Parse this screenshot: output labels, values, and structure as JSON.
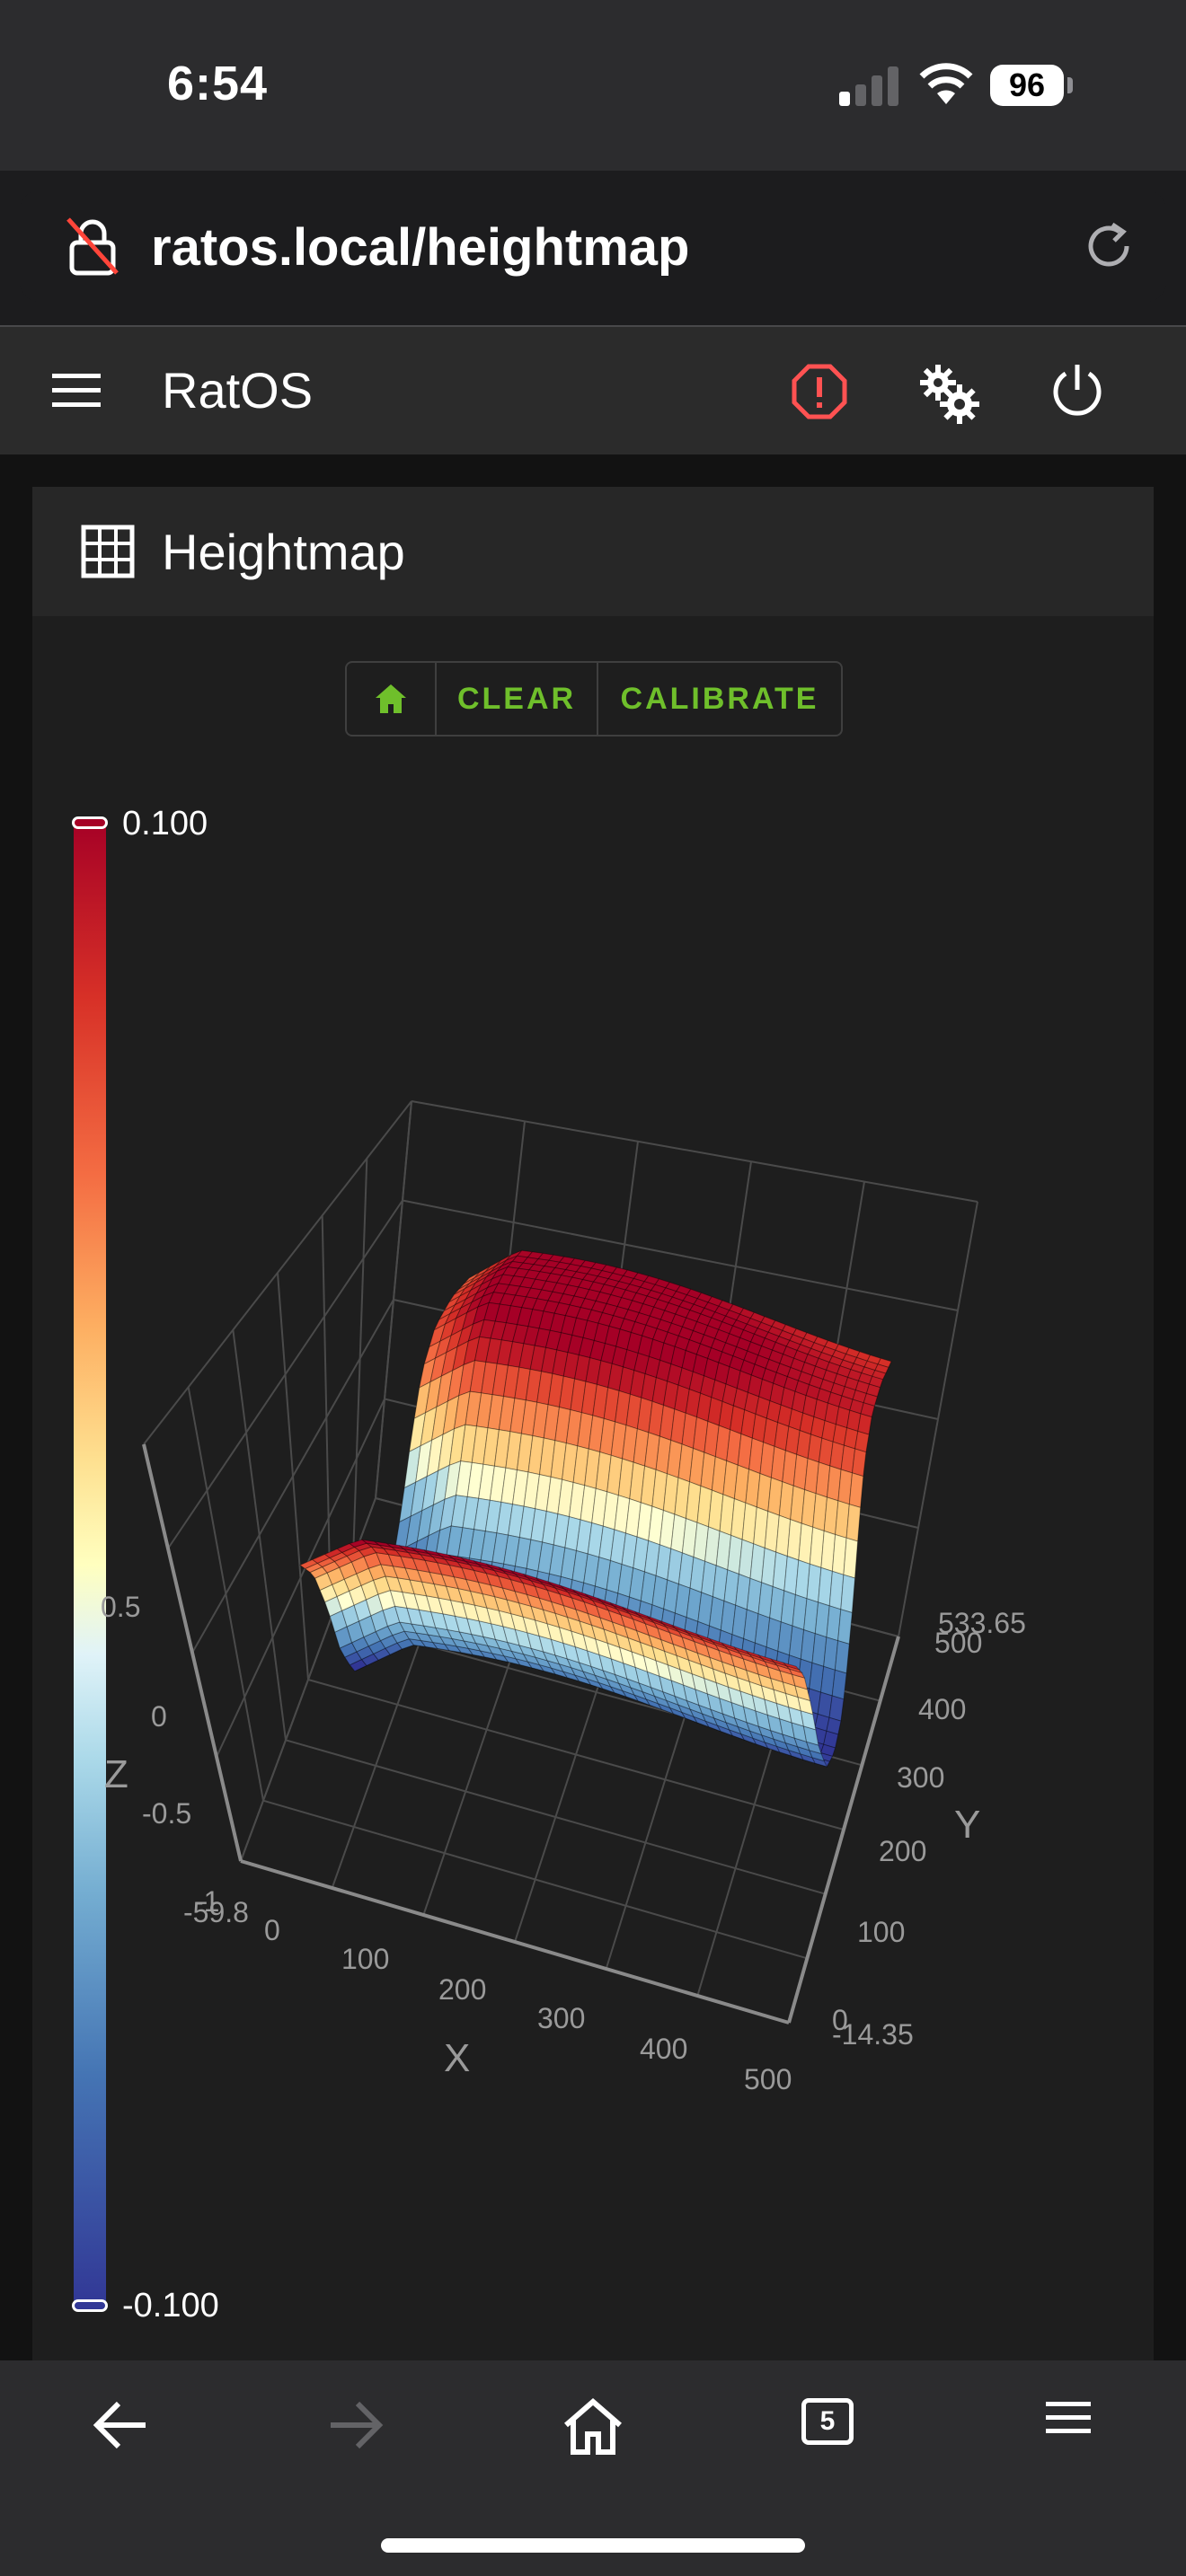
{
  "status_bar": {
    "time": "6:54",
    "battery": "96"
  },
  "browser": {
    "url": "ratos.local/heightmap",
    "tabs_count": "5"
  },
  "app": {
    "title": "RatOS"
  },
  "card": {
    "title": "Heightmap"
  },
  "toolbar": {
    "clear_label": "CLEAR",
    "calibrate_label": "CALIBRATE"
  },
  "colorbar": {
    "max_label": "0.100",
    "min_label": "-0.100",
    "max": 0.1,
    "min": -0.1
  },
  "chart_data": {
    "type": "surface3d",
    "x_title": "X",
    "y_title": "Y",
    "z_title": "Z",
    "x_ticks": [
      "-59.8",
      "0",
      "100",
      "200",
      "300",
      "400",
      "500"
    ],
    "y_ticks": [
      "-14.35",
      "0",
      "100",
      "200",
      "300",
      "400",
      "500",
      "533.65"
    ],
    "z_ticks": [
      "-1",
      "-0.5",
      "0",
      "0.5"
    ],
    "x_range": [
      -59.8,
      500
    ],
    "y_range": [
      -14.35,
      533.65
    ],
    "z_range": [
      -1,
      1
    ],
    "colorscale_range": [
      -0.1,
      0.1
    ],
    "y_profile": [
      [
        0,
        0.1
      ],
      [
        40,
        0.07
      ],
      [
        80,
        0.02
      ],
      [
        120,
        -0.04
      ],
      [
        160,
        -0.08
      ],
      [
        200,
        -0.09
      ],
      [
        240,
        -0.08
      ],
      [
        270,
        -0.05
      ],
      [
        300,
        -0.01
      ],
      [
        330,
        0.04
      ],
      [
        360,
        0.08
      ],
      [
        400,
        0.1
      ],
      [
        450,
        0.1
      ],
      [
        500,
        0.09
      ]
    ]
  }
}
